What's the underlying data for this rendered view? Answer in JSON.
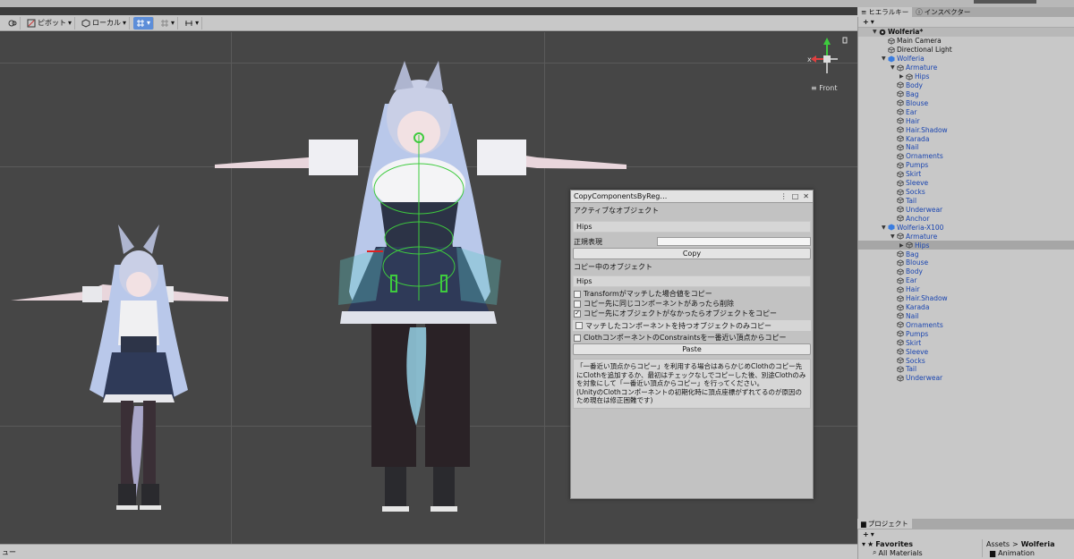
{
  "toolbar": {
    "pivot": "ピボット",
    "local": "ローカル"
  },
  "scene": {
    "gizmo_x": "x",
    "gizmo_view": "Front"
  },
  "bottom": {
    "tab": "ュー"
  },
  "copy_window": {
    "title": "CopyComponentsByReg…",
    "active_object_label": "アクティブなオブジェクト",
    "active_object_value": "Hips",
    "regex_label": "正規表現",
    "regex_value": "",
    "copy_button": "Copy",
    "copying_label": "コピー中のオブジェクト",
    "copying_value": "Hips",
    "options": [
      {
        "label": "Transformがマッチした場合値をコピー",
        "checked": false
      },
      {
        "label": "コピー先に同じコンポーネントがあったら削除",
        "checked": false
      },
      {
        "label": "コピー先にオブジェクトがなかったらオブジェクトをコピー",
        "checked": true
      },
      {
        "label": "マッチしたコンポーネントを持つオブジェクトのみコピー",
        "checked": false
      },
      {
        "label": "ClothコンポーネントのConstraintsを一番近い頂点からコピー",
        "checked": false
      }
    ],
    "paste_button": "Paste",
    "note": "「一番近い頂点からコピー」を利用する場合はあらかじめClothのコピー先にClothを追加するか、最初はチェックなしでコピーした後、別途Clothのみを対象にして「一番近い頂点からコピー」を行ってください。\n(UnityのClothコンポーネントの初期化時に頂点座標がずれてるのが原因のため現在は修正困難です)"
  },
  "hierarchy": {
    "tab_label": "ヒエラルキー",
    "inspector_tab": "インスペクター",
    "add_label": "+",
    "items": [
      {
        "label": "Wolferia*",
        "depth": 0,
        "kind": "root",
        "arrow": "▼"
      },
      {
        "label": "Main Camera",
        "depth": 1,
        "kind": "plain",
        "arrow": ""
      },
      {
        "label": "Directional Light",
        "depth": 1,
        "kind": "plain",
        "arrow": ""
      },
      {
        "label": "Wolferia",
        "depth": 1,
        "kind": "prefab-root",
        "arrow": "▼"
      },
      {
        "label": "Armature",
        "depth": 2,
        "kind": "prefab",
        "arrow": "▼"
      },
      {
        "label": "Hips",
        "depth": 3,
        "kind": "prefab",
        "arrow": "▶"
      },
      {
        "label": "Body",
        "depth": 2,
        "kind": "prefab",
        "arrow": ""
      },
      {
        "label": "Bag",
        "depth": 2,
        "kind": "prefab",
        "arrow": ""
      },
      {
        "label": "Blouse",
        "depth": 2,
        "kind": "prefab",
        "arrow": ""
      },
      {
        "label": "Ear",
        "depth": 2,
        "kind": "prefab",
        "arrow": ""
      },
      {
        "label": "Hair",
        "depth": 2,
        "kind": "prefab",
        "arrow": ""
      },
      {
        "label": "Hair.Shadow",
        "depth": 2,
        "kind": "prefab",
        "arrow": ""
      },
      {
        "label": "Karada",
        "depth": 2,
        "kind": "prefab",
        "arrow": ""
      },
      {
        "label": "Nail",
        "depth": 2,
        "kind": "prefab",
        "arrow": ""
      },
      {
        "label": "Ornaments",
        "depth": 2,
        "kind": "prefab",
        "arrow": ""
      },
      {
        "label": "Pumps",
        "depth": 2,
        "kind": "prefab",
        "arrow": ""
      },
      {
        "label": "Skirt",
        "depth": 2,
        "kind": "prefab",
        "arrow": ""
      },
      {
        "label": "Sleeve",
        "depth": 2,
        "kind": "prefab",
        "arrow": ""
      },
      {
        "label": "Socks",
        "depth": 2,
        "kind": "prefab",
        "arrow": ""
      },
      {
        "label": "Tail",
        "depth": 2,
        "kind": "prefab",
        "arrow": ""
      },
      {
        "label": "Underwear",
        "depth": 2,
        "kind": "prefab",
        "arrow": ""
      },
      {
        "label": "Anchor",
        "depth": 2,
        "kind": "prefab",
        "arrow": ""
      },
      {
        "label": "Wolferia-X100",
        "depth": 1,
        "kind": "prefab-root",
        "arrow": "▼"
      },
      {
        "label": "Armature",
        "depth": 2,
        "kind": "prefab",
        "arrow": "▼"
      },
      {
        "label": "Hips",
        "depth": 3,
        "kind": "selected",
        "arrow": "▶"
      },
      {
        "label": "Bag",
        "depth": 2,
        "kind": "prefab",
        "arrow": ""
      },
      {
        "label": "Blouse",
        "depth": 2,
        "kind": "prefab",
        "arrow": ""
      },
      {
        "label": "Body",
        "depth": 2,
        "kind": "prefab",
        "arrow": ""
      },
      {
        "label": "Ear",
        "depth": 2,
        "kind": "prefab",
        "arrow": ""
      },
      {
        "label": "Hair",
        "depth": 2,
        "kind": "prefab",
        "arrow": ""
      },
      {
        "label": "Hair.Shadow",
        "depth": 2,
        "kind": "prefab",
        "arrow": ""
      },
      {
        "label": "Karada",
        "depth": 2,
        "kind": "prefab",
        "arrow": ""
      },
      {
        "label": "Nail",
        "depth": 2,
        "kind": "prefab",
        "arrow": ""
      },
      {
        "label": "Ornaments",
        "depth": 2,
        "kind": "prefab",
        "arrow": ""
      },
      {
        "label": "Pumps",
        "depth": 2,
        "kind": "prefab",
        "arrow": ""
      },
      {
        "label": "Skirt",
        "depth": 2,
        "kind": "prefab",
        "arrow": ""
      },
      {
        "label": "Sleeve",
        "depth": 2,
        "kind": "prefab",
        "arrow": ""
      },
      {
        "label": "Socks",
        "depth": 2,
        "kind": "prefab",
        "arrow": ""
      },
      {
        "label": "Tail",
        "depth": 2,
        "kind": "prefab",
        "arrow": ""
      },
      {
        "label": "Underwear",
        "depth": 2,
        "kind": "prefab",
        "arrow": ""
      }
    ]
  },
  "project": {
    "tab_label": "プロジェクト",
    "add_label": "+",
    "favorites": "Favorites",
    "all_materials": "All Materials",
    "breadcrumb_root": "Assets",
    "breadcrumb_sep": ">",
    "breadcrumb_current": "Wolferia",
    "folder": "Animation"
  },
  "colors": {
    "prefab_text": "#1a45b0",
    "selection": "#a6a6a6",
    "toolbar_active": "#5d8ed9"
  }
}
